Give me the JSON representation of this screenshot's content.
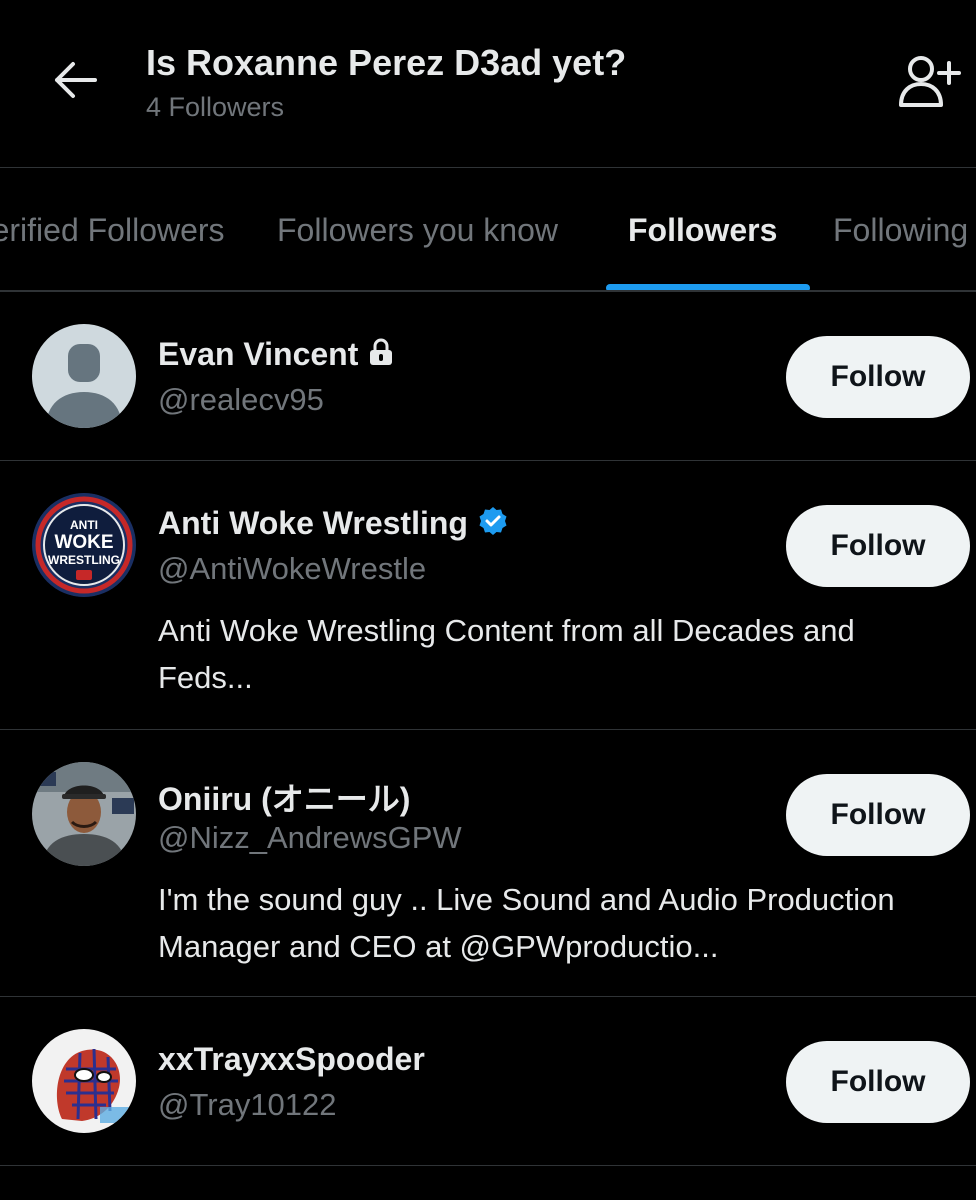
{
  "header": {
    "title": "Is Roxanne Perez D3ad yet?",
    "subtitle": "4 Followers",
    "back_icon": "arrow-left-icon",
    "add_user_icon": "add-user-icon"
  },
  "tabs": [
    {
      "label": "Verified Followers",
      "active": false
    },
    {
      "label": "Followers you know",
      "active": false
    },
    {
      "label": "Followers",
      "active": true
    },
    {
      "label": "Following",
      "active": false
    }
  ],
  "accent_color": "#1d9bf0",
  "follow_label": "Follow",
  "users": [
    {
      "name": "Evan Vincent",
      "badge": "lock-icon",
      "handle": "@realecv95",
      "bio": ""
    },
    {
      "name": "Anti Woke Wrestling",
      "badge": "verified-badge-icon",
      "handle": "@AntiWokeWrestle",
      "bio": "Anti Woke Wrestling Content from all Decades and Feds...",
      "avatar_text_top": "ANTI",
      "avatar_text_mid": "WOKE",
      "avatar_text_bottom": "WRESTLING"
    },
    {
      "name": "Oniiru (オニール)",
      "badge": "",
      "handle": "@Nizz_AndrewsGPW",
      "bio": "I'm the sound guy .. Live Sound and Audio Production Manager and CEO at @GPWproductio..."
    },
    {
      "name": "xxTrayxxSpooder",
      "badge": "",
      "handle": "@Tray10122",
      "bio": ""
    }
  ]
}
